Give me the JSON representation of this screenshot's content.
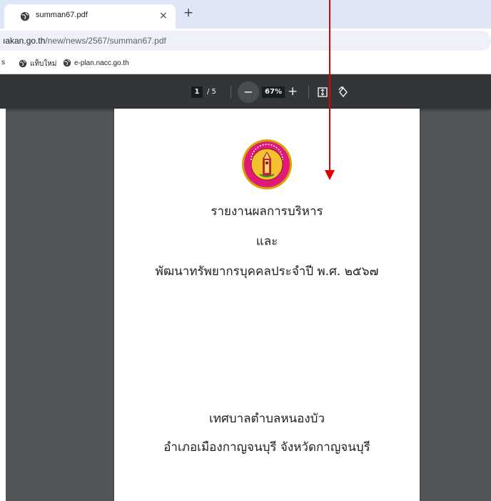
{
  "browser": {
    "tab": {
      "title": "summan67.pdf",
      "close_glyph": "×"
    },
    "new_tab_glyph": "+",
    "address": {
      "host": "ıakan.go.th",
      "path": "/new/news/2567/summan67.pdf"
    },
    "bookmarks": [
      {
        "label": "s"
      },
      {
        "label": "แท็บใหม่"
      },
      {
        "label": "e-plan.nacc.go.th"
      }
    ]
  },
  "pdf_toolbar": {
    "current_page": "1",
    "page_separator": "/ 5",
    "zoom_out_glyph": "−",
    "zoom_level": "67%",
    "zoom_in_glyph": "+",
    "icons": [
      "fit-to-page-icon",
      "rotate-icon"
    ]
  },
  "document": {
    "title_line1": "รายงานผลการบริหาร",
    "title_line2": "และ",
    "title_line3": "พัฒนาทรัพยากรบุคคลประจำปี พ.ศ. ๒๕๖๗",
    "org_line1": "เทศบาลตำบลหนองบัว",
    "org_line2": "อำเภอเมืองกาญจนบุรี จังหวัดกาญจนบุรี",
    "seal_icon": "municipality-seal"
  },
  "annotation": {
    "arrow_color": "#e00000"
  }
}
